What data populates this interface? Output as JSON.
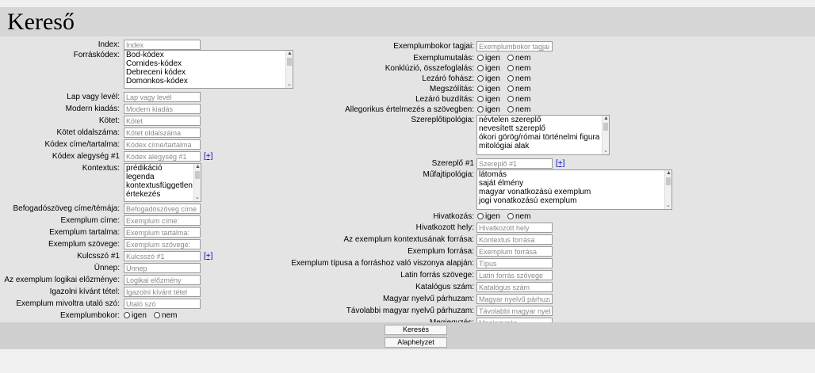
{
  "title": "Kereső",
  "left": {
    "index": {
      "label": "Index:",
      "placeholder": "Index"
    },
    "forraskodex": {
      "label": "Forráskódex:",
      "options": [
        "Bod-kódex",
        "Cornides-kódex",
        "Debreceni kódex",
        "Domonkos-kódex"
      ]
    },
    "lap": {
      "label": "Lap vagy levél:",
      "placeholder": "Lap vagy levél"
    },
    "modern": {
      "label": "Modern kiadás:",
      "placeholder": "Modern kiadás"
    },
    "kotet": {
      "label": "Kötet:",
      "placeholder": "Kötet"
    },
    "oldalszam": {
      "label": "Kötet oldalszáma:",
      "placeholder": "Kötet oldalszáma"
    },
    "kodexcim": {
      "label": "Kódex címe/tartalma:",
      "placeholder": "Kódex címe/tartalma"
    },
    "alegyseg": {
      "label": "Kódex alegység #1",
      "placeholder": "Kódex alegység #1",
      "add": "[+]"
    },
    "kontextus": {
      "label": "Kontextus:",
      "options": [
        "prédikáció",
        "legenda",
        "kontextusfüggetlen",
        "értekezés"
      ]
    },
    "befogado": {
      "label": "Befogadószöveg címe/témája:",
      "placeholder": "Befogadószöveg címe"
    },
    "excim": {
      "label": "Exemplum címe:",
      "placeholder": "Exemplum címe:"
    },
    "extartalma": {
      "label": "Exemplum tartalma:",
      "placeholder": "Exemplum tartalma:"
    },
    "exszovege": {
      "label": "Exemplum szövege:",
      "placeholder": "Exemplum szövege:"
    },
    "kulcsszo": {
      "label": "Kulcsszó #1",
      "placeholder": "Kulcsszó #1",
      "add": "[+]"
    },
    "unnep": {
      "label": "Ünnep:",
      "placeholder": "Ünnep"
    },
    "elozmeny": {
      "label": "Az exemplum logikai előzménye:",
      "placeholder": "Logikai előzmény"
    },
    "igazolni": {
      "label": "Igazolni kívánt tétel:",
      "placeholder": "Igazolni kívánt tétel"
    },
    "mivolt": {
      "label": "Exemplum mivoltra utaló szó:",
      "placeholder": "Utaló szó"
    },
    "bokor": {
      "label": "Exemplumbokor:",
      "yes": "igen",
      "no": "nem"
    }
  },
  "right": {
    "bokortagjai": {
      "label": "Exemplumbokor tagjai:",
      "placeholder": "Exemplumbokor tagjai"
    },
    "utalas": {
      "label": "Exemplumutalás:",
      "yes": "igen",
      "no": "nem"
    },
    "konkluzio": {
      "label": "Konklúzió, összefoglalás:",
      "yes": "igen",
      "no": "nem"
    },
    "fohasz": {
      "label": "Lezáró fohász:",
      "yes": "igen",
      "no": "nem"
    },
    "megszolitas": {
      "label": "Megszólítás:",
      "yes": "igen",
      "no": "nem"
    },
    "buzditas": {
      "label": "Lezáró buzdítás:",
      "yes": "igen",
      "no": "nem"
    },
    "allegorikus": {
      "label": "Allegorikus értelmezés a szövegben:",
      "yes": "igen",
      "no": "nem"
    },
    "szereplotip": {
      "label": "Szereplőtipológia:",
      "options": [
        "névtelen szereplő",
        "nevesített szereplő",
        "ókori görög/római történelmi figura",
        "mitológiai alak"
      ]
    },
    "szereplo": {
      "label": "Szereplő #1",
      "placeholder": "Szereplő #1",
      "add": "[+]"
    },
    "mufaj": {
      "label": "Műfajtipológia:",
      "options": [
        "látomás",
        "saját élmény",
        "magyar vonatkozású exemplum",
        "jogi vonatkozású exemplum"
      ]
    },
    "hivatkozas": {
      "label": "Hivatkozás:",
      "yes": "igen",
      "no": "nem"
    },
    "hivhely": {
      "label": "Hivatkozott hely:",
      "placeholder": "Hivatkozott hely"
    },
    "kontforras": {
      "label": "Az exemplum kontextusának forrása:",
      "placeholder": "Kontextus forrása"
    },
    "exforras": {
      "label": "Exemplum forrása:",
      "placeholder": "Exemplum forrása"
    },
    "tipus": {
      "label": "Exemplum típusa a forráshoz való viszonya alapján:",
      "placeholder": "Típus"
    },
    "latin": {
      "label": "Latin forrás szövege:",
      "placeholder": "Latin forrás szövege"
    },
    "katalogus": {
      "label": "Katalógus szám:",
      "placeholder": "Katalógus szám"
    },
    "magyarpar": {
      "label": "Magyar nyelvű párhuzam:",
      "placeholder": "Magyar nyelvű párhuzam"
    },
    "tavolabbi": {
      "label": "Távolabbi magyar nyelvű párhuzam:",
      "placeholder": "Távolabbi magyar nyelv"
    },
    "megjegyzes": {
      "label": "Megjegyzés:",
      "placeholder": "Megjegyzés"
    }
  },
  "buttons": {
    "search": "Keresés",
    "reset": "Alaphelyzet"
  }
}
